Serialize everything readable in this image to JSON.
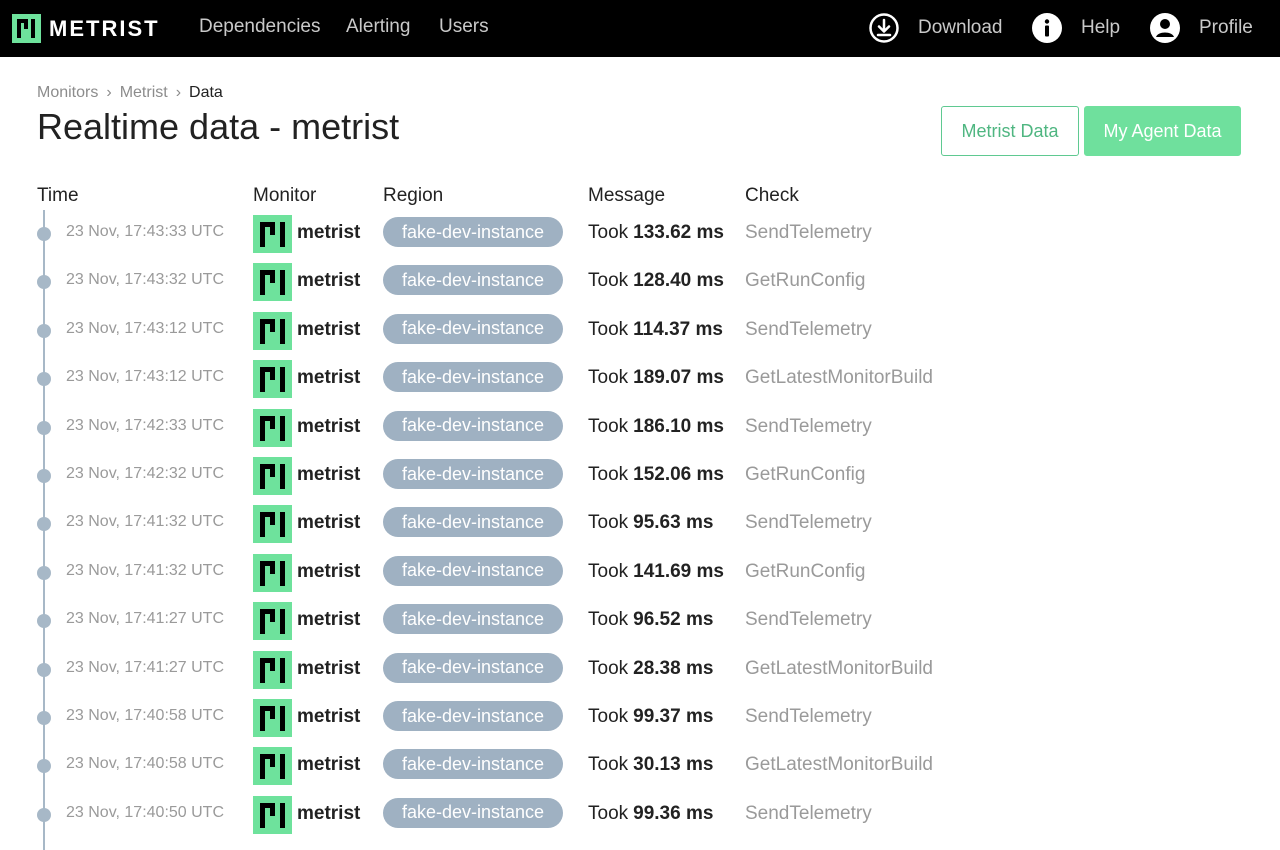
{
  "brand": {
    "name": "METRIST",
    "accent": "#6ee29c"
  },
  "nav": {
    "links": [
      "Dependencies",
      "Alerting",
      "Users"
    ],
    "download": "Download",
    "help": "Help",
    "profile": "Profile"
  },
  "breadcrumb": [
    "Monitors",
    "Metrist",
    "Data"
  ],
  "page_title": "Realtime data - metrist",
  "buttons": {
    "metrist_data": "Metrist Data",
    "my_agent_data": "My Agent Data"
  },
  "columns": {
    "time": "Time",
    "monitor": "Monitor",
    "region": "Region",
    "message": "Message",
    "check": "Check"
  },
  "message_prefix": "Took",
  "rows": [
    {
      "time": "23 Nov, 17:43:33 UTC",
      "monitor": "metrist",
      "region": "fake-dev-instance",
      "duration": "133.62 ms",
      "check": "SendTelemetry"
    },
    {
      "time": "23 Nov, 17:43:32 UTC",
      "monitor": "metrist",
      "region": "fake-dev-instance",
      "duration": "128.40 ms",
      "check": "GetRunConfig"
    },
    {
      "time": "23 Nov, 17:43:12 UTC",
      "monitor": "metrist",
      "region": "fake-dev-instance",
      "duration": "114.37 ms",
      "check": "SendTelemetry"
    },
    {
      "time": "23 Nov, 17:43:12 UTC",
      "monitor": "metrist",
      "region": "fake-dev-instance",
      "duration": "189.07 ms",
      "check": "GetLatestMonitorBuild"
    },
    {
      "time": "23 Nov, 17:42:33 UTC",
      "monitor": "metrist",
      "region": "fake-dev-instance",
      "duration": "186.10 ms",
      "check": "SendTelemetry"
    },
    {
      "time": "23 Nov, 17:42:32 UTC",
      "monitor": "metrist",
      "region": "fake-dev-instance",
      "duration": "152.06 ms",
      "check": "GetRunConfig"
    },
    {
      "time": "23 Nov, 17:41:32 UTC",
      "monitor": "metrist",
      "region": "fake-dev-instance",
      "duration": "95.63 ms",
      "check": "SendTelemetry"
    },
    {
      "time": "23 Nov, 17:41:32 UTC",
      "monitor": "metrist",
      "region": "fake-dev-instance",
      "duration": "141.69 ms",
      "check": "GetRunConfig"
    },
    {
      "time": "23 Nov, 17:41:27 UTC",
      "monitor": "metrist",
      "region": "fake-dev-instance",
      "duration": "96.52 ms",
      "check": "SendTelemetry"
    },
    {
      "time": "23 Nov, 17:41:27 UTC",
      "monitor": "metrist",
      "region": "fake-dev-instance",
      "duration": "28.38 ms",
      "check": "GetLatestMonitorBuild"
    },
    {
      "time": "23 Nov, 17:40:58 UTC",
      "monitor": "metrist",
      "region": "fake-dev-instance",
      "duration": "99.37 ms",
      "check": "SendTelemetry"
    },
    {
      "time": "23 Nov, 17:40:58 UTC",
      "monitor": "metrist",
      "region": "fake-dev-instance",
      "duration": "30.13 ms",
      "check": "GetLatestMonitorBuild"
    },
    {
      "time": "23 Nov, 17:40:50 UTC",
      "monitor": "metrist",
      "region": "fake-dev-instance",
      "duration": "99.36 ms",
      "check": "SendTelemetry"
    }
  ]
}
